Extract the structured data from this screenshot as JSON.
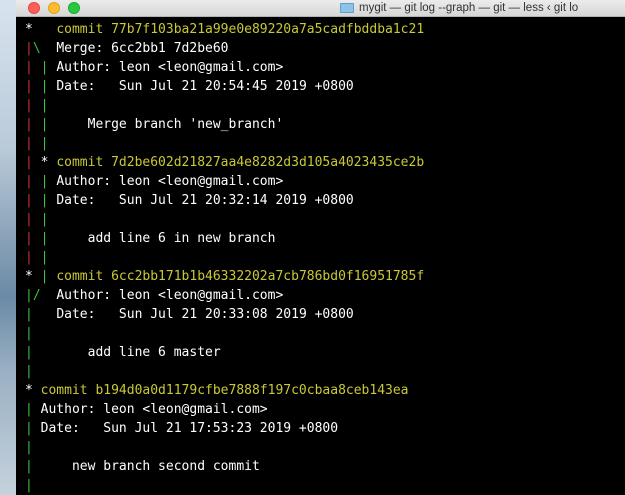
{
  "window": {
    "title": "mygit — git log --graph — git — less ‹ git lo"
  },
  "terminal_lines": [
    {
      "graph": [
        [
          "*",
          "star"
        ],
        [
          "   ",
          "w"
        ]
      ],
      "text": [
        [
          "commit 77b7f103ba21a99e0e89220a7a5cadfbddba1c21",
          "y"
        ]
      ]
    },
    {
      "graph": [
        [
          "|",
          "r"
        ],
        [
          "\\",
          "g"
        ],
        [
          "  ",
          "w"
        ]
      ],
      "text": [
        [
          "Merge: 6cc2bb1 7d2be60",
          "w"
        ]
      ]
    },
    {
      "graph": [
        [
          "|",
          "r"
        ],
        [
          " ",
          "w"
        ],
        [
          "|",
          "g"
        ],
        [
          " ",
          "w"
        ]
      ],
      "text": [
        [
          "Author: leon <leon@gmail.com>",
          "w"
        ]
      ]
    },
    {
      "graph": [
        [
          "|",
          "r"
        ],
        [
          " ",
          "w"
        ],
        [
          "|",
          "g"
        ],
        [
          " ",
          "w"
        ]
      ],
      "text": [
        [
          "Date:   Sun Jul 21 20:54:45 2019 +0800",
          "w"
        ]
      ]
    },
    {
      "graph": [
        [
          "|",
          "r"
        ],
        [
          " ",
          "w"
        ],
        [
          "|",
          "g"
        ]
      ],
      "text": []
    },
    {
      "graph": [
        [
          "|",
          "r"
        ],
        [
          " ",
          "w"
        ],
        [
          "|",
          "g"
        ],
        [
          " ",
          "w"
        ]
      ],
      "text": [
        [
          "    Merge branch 'new_branch'",
          "w"
        ]
      ]
    },
    {
      "graph": [
        [
          "|",
          "r"
        ],
        [
          " ",
          "w"
        ],
        [
          "|",
          "g"
        ]
      ],
      "text": []
    },
    {
      "graph": [
        [
          "|",
          "r"
        ],
        [
          " ",
          "w"
        ],
        [
          "*",
          "star"
        ],
        [
          " ",
          "w"
        ]
      ],
      "text": [
        [
          "commit 7d2be602d21827aa4e8282d3d105a4023435ce2b",
          "y"
        ]
      ]
    },
    {
      "graph": [
        [
          "|",
          "r"
        ],
        [
          " ",
          "w"
        ],
        [
          "|",
          "g"
        ],
        [
          " ",
          "w"
        ]
      ],
      "text": [
        [
          "Author: leon <leon@gmail.com>",
          "w"
        ]
      ]
    },
    {
      "graph": [
        [
          "|",
          "r"
        ],
        [
          " ",
          "w"
        ],
        [
          "|",
          "g"
        ],
        [
          " ",
          "w"
        ]
      ],
      "text": [
        [
          "Date:   Sun Jul 21 20:32:14 2019 +0800",
          "w"
        ]
      ]
    },
    {
      "graph": [
        [
          "|",
          "r"
        ],
        [
          " ",
          "w"
        ],
        [
          "|",
          "g"
        ]
      ],
      "text": []
    },
    {
      "graph": [
        [
          "|",
          "r"
        ],
        [
          " ",
          "w"
        ],
        [
          "|",
          "g"
        ],
        [
          " ",
          "w"
        ]
      ],
      "text": [
        [
          "    add line 6 in new branch",
          "w"
        ]
      ]
    },
    {
      "graph": [
        [
          "|",
          "r"
        ],
        [
          " ",
          "w"
        ],
        [
          "|",
          "g"
        ]
      ],
      "text": []
    },
    {
      "graph": [
        [
          "*",
          "star"
        ],
        [
          " ",
          "w"
        ],
        [
          "|",
          "g"
        ],
        [
          " ",
          "w"
        ]
      ],
      "text": [
        [
          "commit 6cc2bb171b1b46332202a7cb786bd0f16951785f",
          "y"
        ]
      ]
    },
    {
      "graph": [
        [
          "|",
          "g"
        ],
        [
          "/",
          "g"
        ],
        [
          "  ",
          "w"
        ]
      ],
      "text": [
        [
          "Author: leon <leon@gmail.com>",
          "w"
        ]
      ]
    },
    {
      "graph": [
        [
          "|",
          "g"
        ],
        [
          "   ",
          "w"
        ]
      ],
      "text": [
        [
          "Date:   Sun Jul 21 20:33:08 2019 +0800",
          "w"
        ]
      ]
    },
    {
      "graph": [
        [
          "|",
          "g"
        ]
      ],
      "text": []
    },
    {
      "graph": [
        [
          "|",
          "g"
        ],
        [
          "   ",
          "w"
        ]
      ],
      "text": [
        [
          "    add line 6 master",
          "w"
        ]
      ]
    },
    {
      "graph": [
        [
          "|",
          "g"
        ]
      ],
      "text": []
    },
    {
      "graph": [
        [
          "*",
          "star"
        ],
        [
          " ",
          "w"
        ]
      ],
      "text": [
        [
          "commit b194d0a0d1179cfbe7888f197c0cbaa8ceb143ea",
          "y"
        ]
      ]
    },
    {
      "graph": [
        [
          "|",
          "g"
        ],
        [
          " ",
          "w"
        ]
      ],
      "text": [
        [
          "Author: leon <leon@gmail.com>",
          "w"
        ]
      ]
    },
    {
      "graph": [
        [
          "|",
          "g"
        ],
        [
          " ",
          "w"
        ]
      ],
      "text": [
        [
          "Date:   Sun Jul 21 17:53:23 2019 +0800",
          "w"
        ]
      ]
    },
    {
      "graph": [
        [
          "|",
          "g"
        ]
      ],
      "text": []
    },
    {
      "graph": [
        [
          "|",
          "g"
        ],
        [
          " ",
          "w"
        ]
      ],
      "text": [
        [
          "    new branch second commit",
          "w"
        ]
      ]
    },
    {
      "graph": [
        [
          "|",
          "g"
        ]
      ],
      "text": []
    }
  ],
  "colors": {
    "graph_red": "#d03030",
    "graph_green": "#3cc23c",
    "commit_hash_yellow": "#c9c936",
    "text_white": "#ffffff",
    "background": "#000000"
  }
}
